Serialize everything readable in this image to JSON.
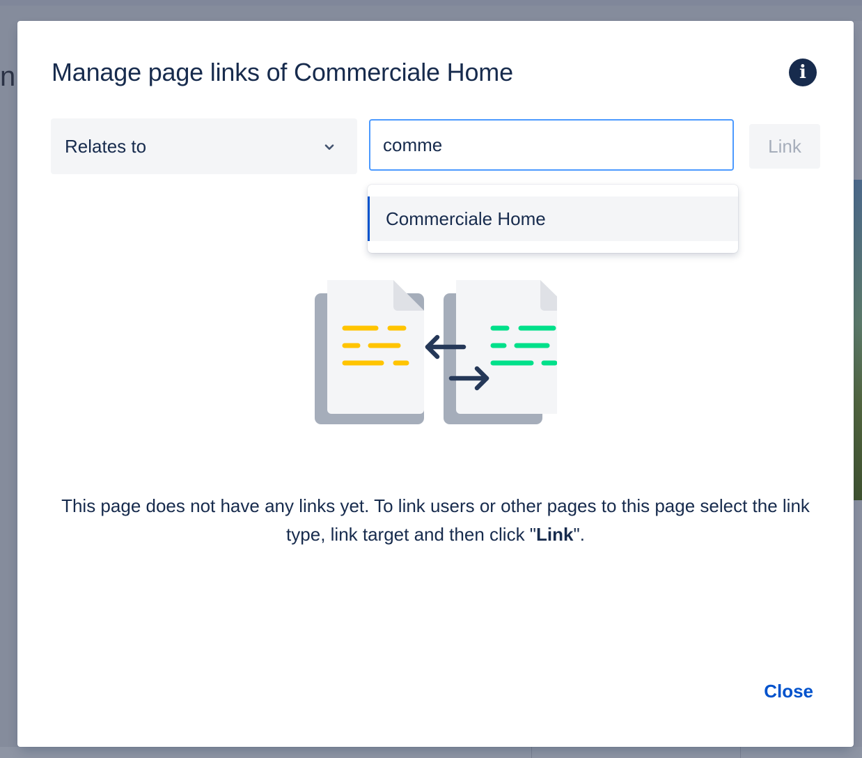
{
  "background": {
    "title_fragment": "n"
  },
  "modal": {
    "title": "Manage page links of Commerciale Home",
    "info_icon": "info-icon",
    "info_glyph": "i"
  },
  "form": {
    "link_type": {
      "selected": "Relates to",
      "icon": "chevron-down-icon"
    },
    "target": {
      "value": "comme"
    },
    "link_button": "Link",
    "suggestions": [
      "Commerciale Home"
    ]
  },
  "empty_state": {
    "text_part1": "This page does not have any links yet. To link users or other pages to this page select the link type, link target and then click \"",
    "text_bold": "Link",
    "text_part2": "\".",
    "illustration": "linked-pages-illustration"
  },
  "footer": {
    "close_label": "Close"
  },
  "colors": {
    "title": "#172b4d",
    "primary": "#0052cc",
    "focus_border": "#4c9aff",
    "disabled_text": "#a5adba",
    "field_bg": "#f4f5f7",
    "doc_yellow": "#ffc400",
    "doc_green": "#00e08a"
  }
}
